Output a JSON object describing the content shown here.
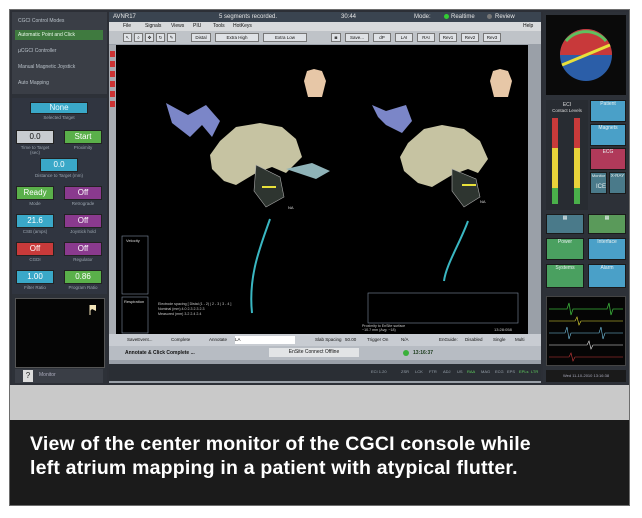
{
  "left_panel": {
    "menu_items": [
      "CGCI Control Modes",
      "Automatic Point and Click",
      "µCGCI Controller",
      "Manual Magnetic Joystick",
      "Auto Mapping"
    ],
    "target_value": "None",
    "target_label": "Selected Target",
    "time_value": "0.0",
    "time_label": "Time to Target (sec)",
    "start_label": "Start",
    "proximity_label": "Proximity",
    "distance_value": "0.0",
    "distance_label": "Distance to Target (mm)",
    "ready_value": "Ready",
    "mode_label": "Mode",
    "off1_value": "Off",
    "retrograde_label": "Retrograde",
    "csb_value": "21.6",
    "csb_label": "CSB (amps)",
    "off2_value": "Off",
    "joystick_label": "Joystick hold",
    "off3_value": "Off",
    "cgdi_label": "CGDI",
    "off4_value": "Off",
    "regulator_label": "Regulator",
    "filter_value": "1.00",
    "filter_label": "Filter Ratio",
    "prog_value": "0.86",
    "prog_label": "Program Ratio",
    "bottom_label": "Monitor"
  },
  "center": {
    "title_left": "AVNR17",
    "title_mid": "5 segments recorded.",
    "title_time": "30:44",
    "mode_label": "Mode:",
    "realtime_label": "Realtime",
    "review_label": "Review",
    "menu": [
      "File",
      "Signals",
      "Views",
      "PIU",
      "Tools",
      "HotKeys",
      "Help"
    ],
    "toolbar": [
      "Distal",
      "Extra High",
      "Extra Low",
      "Save...",
      "dP",
      "LAI",
      "RAI",
      "Rev1",
      "Rev2",
      "Rev3"
    ],
    "na_label1": "NA",
    "na_label2": "NA",
    "velocity_label": "Velocity",
    "respiration_label": "Respiration",
    "electrode_text": "Electrode spacing [ Distal (1 - 2) | 2 - 3 | 3 - 4 ]",
    "nominal_text": "Nominal (mm)    4.0    2.3    2.3    2.3",
    "measured_text": "Measured (mm)    3.2    2.4    2.4",
    "proximity_text": "Proximity to EnSite surface",
    "proximity_value": "~10.7 mm (Avg: ~18)",
    "time_stamp": "13:28:058",
    "status_items": [
      "SaveEvent...",
      "Complete",
      "Annotate",
      "LA",
      "Slab Spacing",
      "50.00",
      "Trigger On",
      "N/A",
      "EnGuide:",
      "Disabled",
      "Single",
      "Multi"
    ],
    "status2_left": "Annotate & Click Complete ...",
    "status2_mid": "EnSite Connect Offline",
    "status2_time": "13:16:37",
    "bottom_items": [
      "ECI 1.20",
      "ZSR",
      "LCK",
      "FTR",
      "ADJ",
      "US",
      "RAA",
      "MAG",
      "ECG",
      "EPS",
      "EPLs",
      "LTR"
    ],
    "bottom_date": "Wed 11-10-2010 13:16:38"
  },
  "right_panel": {
    "eci_label": "ECI",
    "contact_label": "Contact Levels",
    "patient_label": "Patient",
    "magnets_label": "Magnets",
    "ecg_label": "ECG",
    "monitor_label": "Monitor",
    "ice_label": "ICE",
    "xray_label": "X-RAY",
    "power_label": "Power",
    "interface_label": "Interface",
    "systems_label": "Systems",
    "alarm_label": "Alarm"
  },
  "caption": {
    "line1": "View of the center monitor of the CGCI console while",
    "line2": "left atrium mapping in a patient with atypical flutter."
  }
}
